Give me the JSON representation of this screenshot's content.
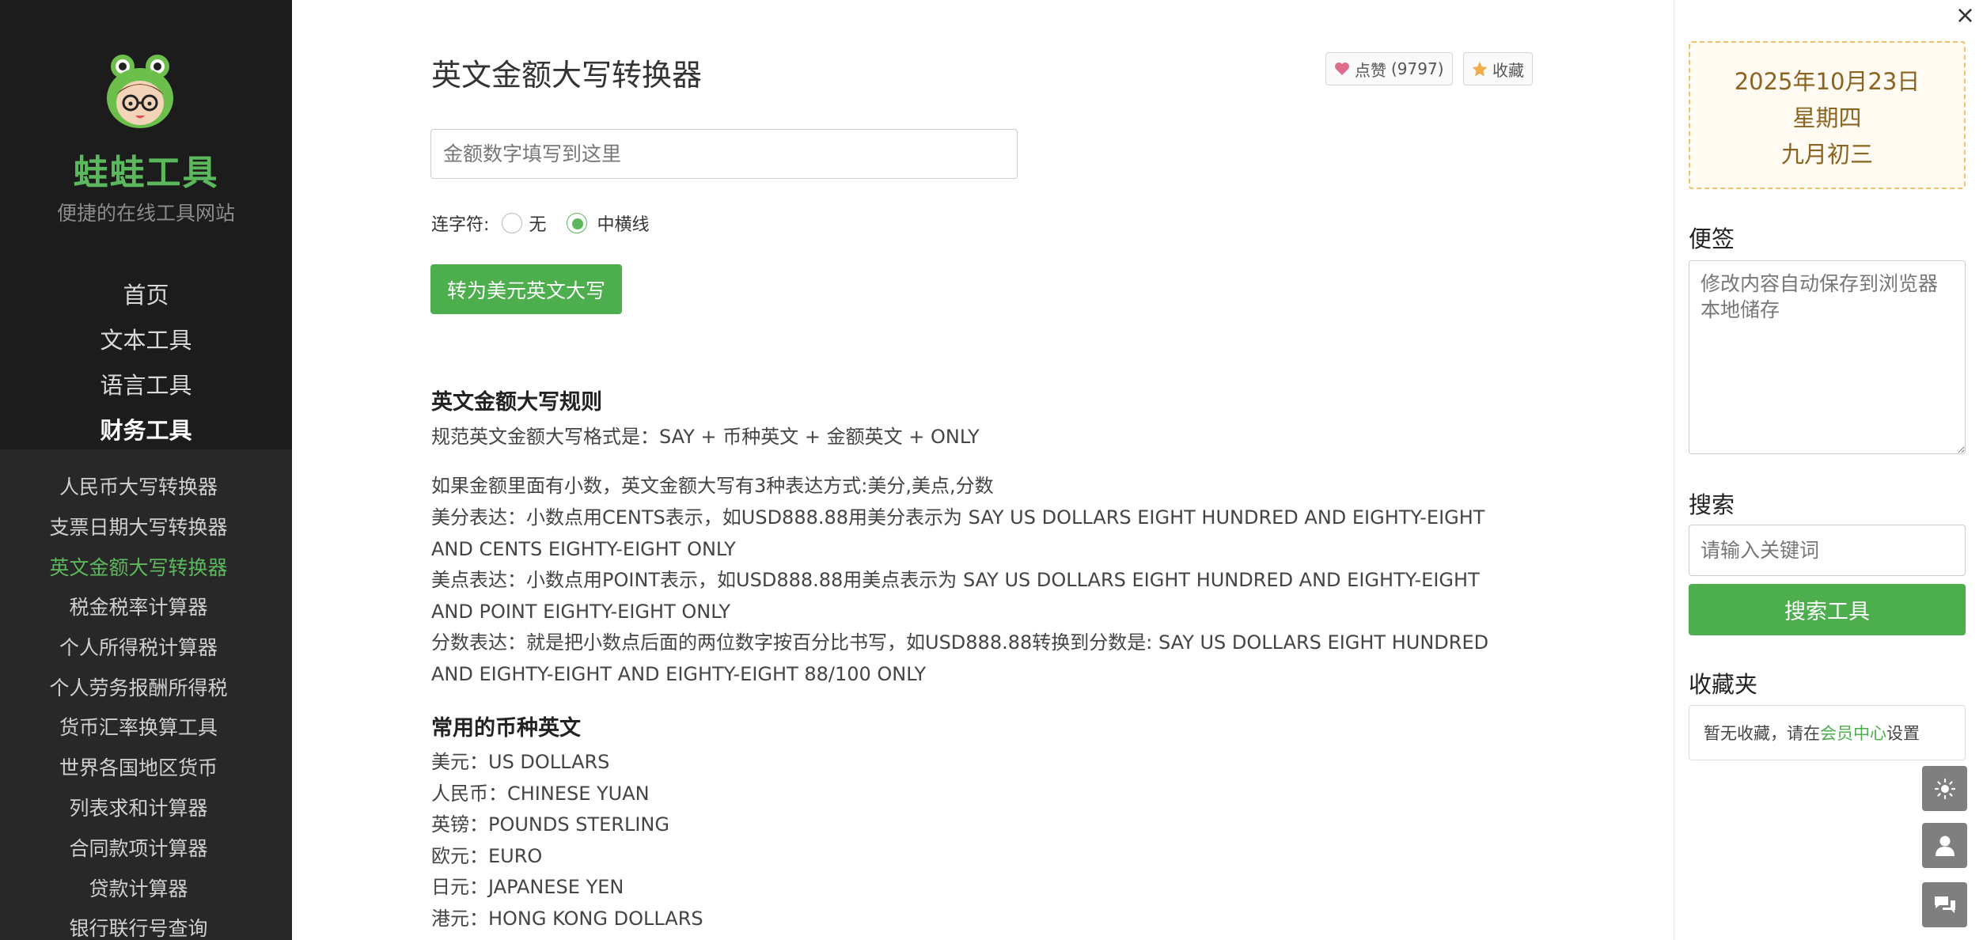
{
  "brand": {
    "title": "蛙蛙工具",
    "subtitle": "便捷的在线工具网站"
  },
  "nav_main": [
    {
      "label": "首页",
      "active": false
    },
    {
      "label": "文本工具",
      "active": false
    },
    {
      "label": "语言工具",
      "active": false
    },
    {
      "label": "财务工具",
      "active": true
    }
  ],
  "nav_sub": [
    {
      "label": "人民币大写转换器",
      "active": false
    },
    {
      "label": "支票日期大写转换器",
      "active": false
    },
    {
      "label": "英文金额大写转换器",
      "active": true
    },
    {
      "label": "税金税率计算器",
      "active": false
    },
    {
      "label": "个人所得税计算器",
      "active": false
    },
    {
      "label": "个人劳务报酬所得税",
      "active": false
    },
    {
      "label": "货币汇率换算工具",
      "active": false
    },
    {
      "label": "世界各国地区货币",
      "active": false
    },
    {
      "label": "列表求和计算器",
      "active": false
    },
    {
      "label": "合同款项计算器",
      "active": false
    },
    {
      "label": "贷款计算器",
      "active": false
    },
    {
      "label": "银行联行号查询",
      "active": false
    }
  ],
  "main": {
    "title": "英文金额大写转换器",
    "like_label": "点赞",
    "like_count": "(9797)",
    "favorite_label": "收藏",
    "amount_placeholder": "金额数字填写到这里",
    "hyphen_label": "连字符:",
    "hyphen_options": [
      {
        "label": "无",
        "checked": false
      },
      {
        "label": "中横线",
        "checked": true
      }
    ],
    "convert_button": "转为美元英文大写",
    "rules_heading": "英文金额大写规则",
    "rules_line1": "规范英文金额大写格式是：SAY + 币种英文 + 金额英文 + ONLY",
    "decimals_intro": "如果金额里面有小数，英文金额大写有3种表达方式:美分,美点,分数",
    "decimals_cents": "美分表达：小数点用CENTS表示，如USD888.88用美分表示为 SAY US DOLLARS EIGHT HUNDRED AND EIGHTY-EIGHT AND CENTS EIGHTY-EIGHT ONLY",
    "decimals_point": "美点表达：小数点用POINT表示，如USD888.88用美点表示为 SAY US DOLLARS EIGHT HUNDRED AND EIGHTY-EIGHT AND POINT EIGHTY-EIGHT ONLY",
    "decimals_fraction": "分数表达：就是把小数点后面的两位数字按百分比书写，如USD888.88转换到分数是: SAY US DOLLARS EIGHT HUNDRED AND EIGHTY-EIGHT AND EIGHTY-EIGHT 88/100 ONLY",
    "currency_heading": "常用的币种英文",
    "currencies": [
      "美元：US DOLLARS",
      "人民币：CHINESE YUAN",
      "英镑：POUNDS STERLING",
      "欧元：EURO",
      "日元：JAPANESE YEN",
      "港元：HONG KONG DOLLARS"
    ]
  },
  "right": {
    "close_symbol": "×",
    "date_line1": "2025年10月23日",
    "date_line2": "星期四",
    "date_line3": "九月初三",
    "notes_title": "便签",
    "notes_placeholder": "修改内容自动保存到浏览器本地储存",
    "search_title": "搜索",
    "search_placeholder": "请输入关键词",
    "search_button": "搜索工具",
    "favorites_title": "收藏夹",
    "favorites_empty_prefix": "暂无收藏，请在",
    "favorites_link": "会员中心",
    "favorites_empty_suffix": "设置"
  },
  "float_buttons": [
    "sun-icon",
    "user-icon",
    "chat-icon"
  ],
  "colors": {
    "brand_green": "#5cb85c",
    "button_green": "#4cae4c",
    "sidebar_bg": "#1f1f1f",
    "date_text": "#8a6420"
  }
}
